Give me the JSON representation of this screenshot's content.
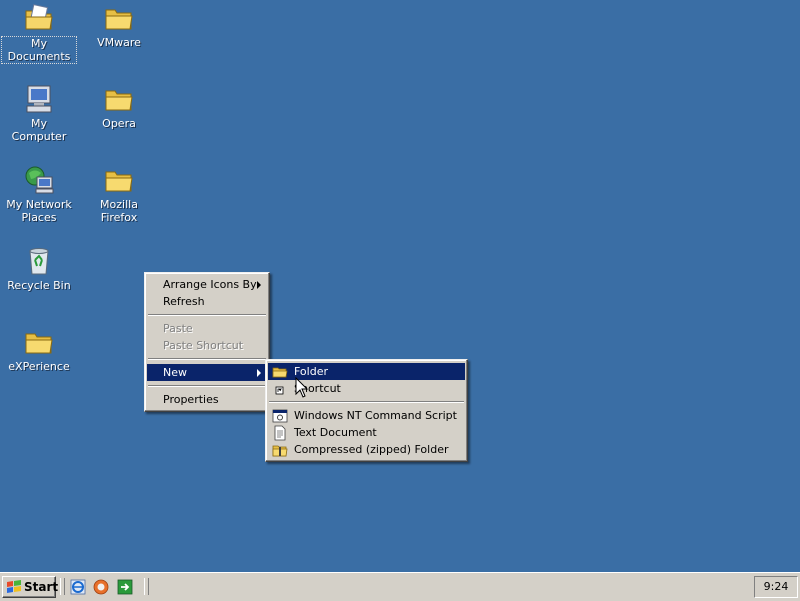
{
  "desktop": {
    "background": "#3a6ea5",
    "icons": [
      {
        "label": "My Documents",
        "icon": "my-documents-icon"
      },
      {
        "label": "VMware",
        "icon": "folder-icon"
      },
      {
        "label": "My Computer",
        "icon": "my-computer-icon"
      },
      {
        "label": "Opera",
        "icon": "folder-icon"
      },
      {
        "label": "My Network Places",
        "icon": "network-places-icon"
      },
      {
        "label": "Mozilla Firefox",
        "icon": "folder-icon"
      },
      {
        "label": "Recycle Bin",
        "icon": "recycle-bin-icon"
      },
      {
        "label": "eXPerience",
        "icon": "folder-icon"
      }
    ]
  },
  "context_menu": {
    "items": [
      {
        "label": "Arrange Icons By",
        "has_submenu": true
      },
      {
        "label": "Refresh"
      },
      {
        "label": "Paste",
        "disabled": true
      },
      {
        "label": "Paste Shortcut",
        "disabled": true
      },
      {
        "label": "New",
        "has_submenu": true,
        "highlighted": true
      },
      {
        "label": "Properties"
      }
    ]
  },
  "new_submenu": {
    "highlight_color": "#0a246a",
    "items": [
      {
        "label": "Folder",
        "icon": "folder-icon",
        "highlighted": true
      },
      {
        "label": "Shortcut",
        "icon": "shortcut-icon"
      },
      {
        "label": "Windows NT Command Script",
        "icon": "command-script-icon"
      },
      {
        "label": "Text Document",
        "icon": "text-document-icon"
      },
      {
        "label": "Compressed (zipped) Folder",
        "icon": "zipped-folder-icon"
      }
    ]
  },
  "taskbar": {
    "start_label": "Start",
    "quick_launch": [
      "internet-explorer-icon",
      "firefox-icon",
      "show-desktop-icon"
    ],
    "clock": "9:24"
  }
}
